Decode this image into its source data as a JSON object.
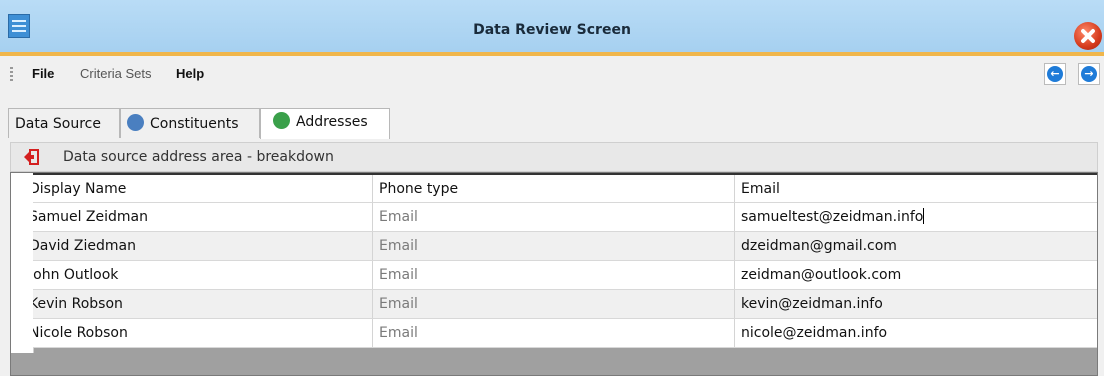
{
  "window": {
    "title": "Data Review Screen"
  },
  "menu": {
    "items": [
      "File",
      "Criteria Sets",
      "Help"
    ]
  },
  "tabs": [
    {
      "label": "Data Source",
      "active": false
    },
    {
      "label": "Constituents",
      "active": false
    },
    {
      "label": "Addresses",
      "active": true
    }
  ],
  "panel": {
    "title": "Data source address area - breakdown"
  },
  "grid": {
    "columns": [
      "Display Name",
      "Phone type",
      "Email"
    ],
    "rows": [
      {
        "name": "Samuel Zeidman",
        "phone_type": "Email",
        "email": "samueltest@zeidman.info"
      },
      {
        "name": "David Ziedman",
        "phone_type": "Email",
        "email": "dzeidman@gmail.com"
      },
      {
        "name": "John Outlook",
        "phone_type": "Email",
        "email": "zeidman@outlook.com"
      },
      {
        "name": "Kevin Robson",
        "phone_type": "Email",
        "email": "kevin@zeidman.info"
      },
      {
        "name": "Nicole Robson",
        "phone_type": "Email",
        "email": "nicole@zeidman.info"
      }
    ]
  },
  "colors": {
    "titlebar": "#a6d0f0",
    "accent_border": "#f0b64b",
    "nav_button": "#1e7bd8",
    "close_button": "#d53a1c"
  },
  "icons": [
    "app-grid-icon",
    "close-icon",
    "back-arrow-icon",
    "forward-arrow-icon",
    "constituents-icon",
    "addresses-home-icon",
    "exit-icon"
  ]
}
